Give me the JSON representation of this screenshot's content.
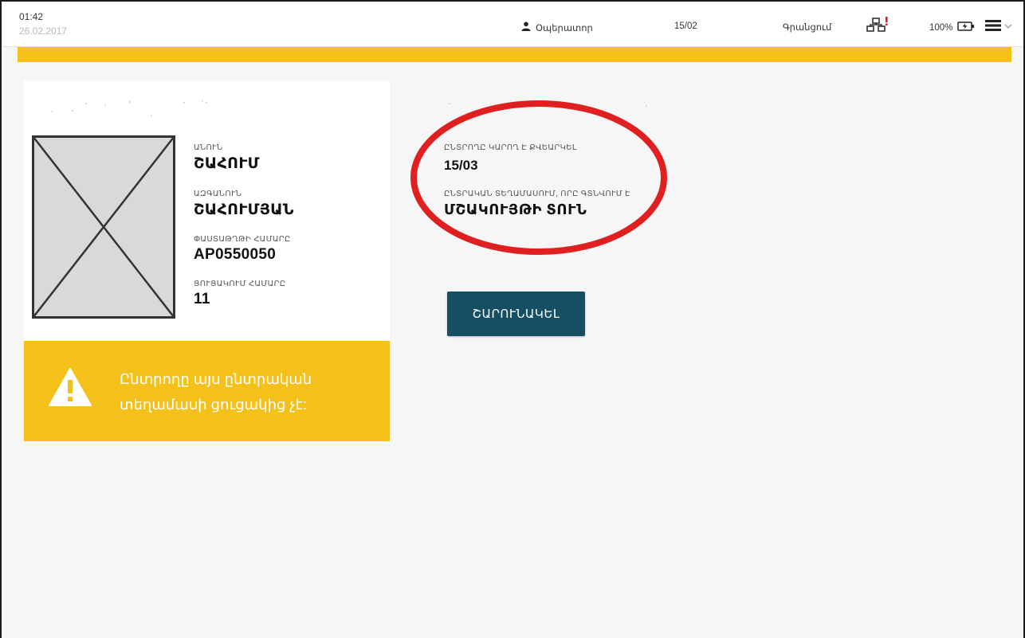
{
  "header": {
    "time": "01:42",
    "date": "26.02.2017",
    "user_label": "Օպերատոր",
    "page": "15/02",
    "status_label": "Գրանցում",
    "battery": "100%",
    "colors": {
      "accent": "#f4c11a",
      "alert": "#e02020"
    },
    "icons": [
      "user-icon",
      "network-icon",
      "battery-icon",
      "menu-icon",
      "chevron-down-icon"
    ]
  },
  "card": {
    "fields": [
      {
        "label": "ԱՆՈՒՆ",
        "value": "ՇԱՀՈՒՄ"
      },
      {
        "label": "ԱԶԳԱՆՈՒՆ",
        "value": "ՇԱՀՈՒՄՅԱՆ"
      },
      {
        "label": "ՓԱՍՏԱԹՂԹԻ ՀԱՄԱՐԸ",
        "value": "AP0550050"
      },
      {
        "label": "ՑՈՒՑԱԿՈՒՄ ՀԱՄԱՐԸ",
        "value": "11"
      }
    ]
  },
  "warning": {
    "icon": "warning-icon",
    "text_line1": "Ընտրողը այս ընտրական",
    "text_line2": "տեղամասի ցուցակից չէ:"
  },
  "info": {
    "vote_label": "ԸՆՏՐՈՂԸ ԿԱՐՈՂ Է ՔՎԵԱՐԿԵԼ",
    "vote_value": "15/03",
    "location_label": "ԸՆՏՐԱԿԱՆ ՏԵՂԱՄԱՍՈՒՄ, ՈՐԸ ԳՏՆՎՈՒՄ Է",
    "location_value": "ՄՇԱԿՈՒՅԹԻ ՏՈՒՆ"
  },
  "actions": {
    "confirm_label": "ՇԱՐՈՒՆԱԿԵԼ"
  }
}
